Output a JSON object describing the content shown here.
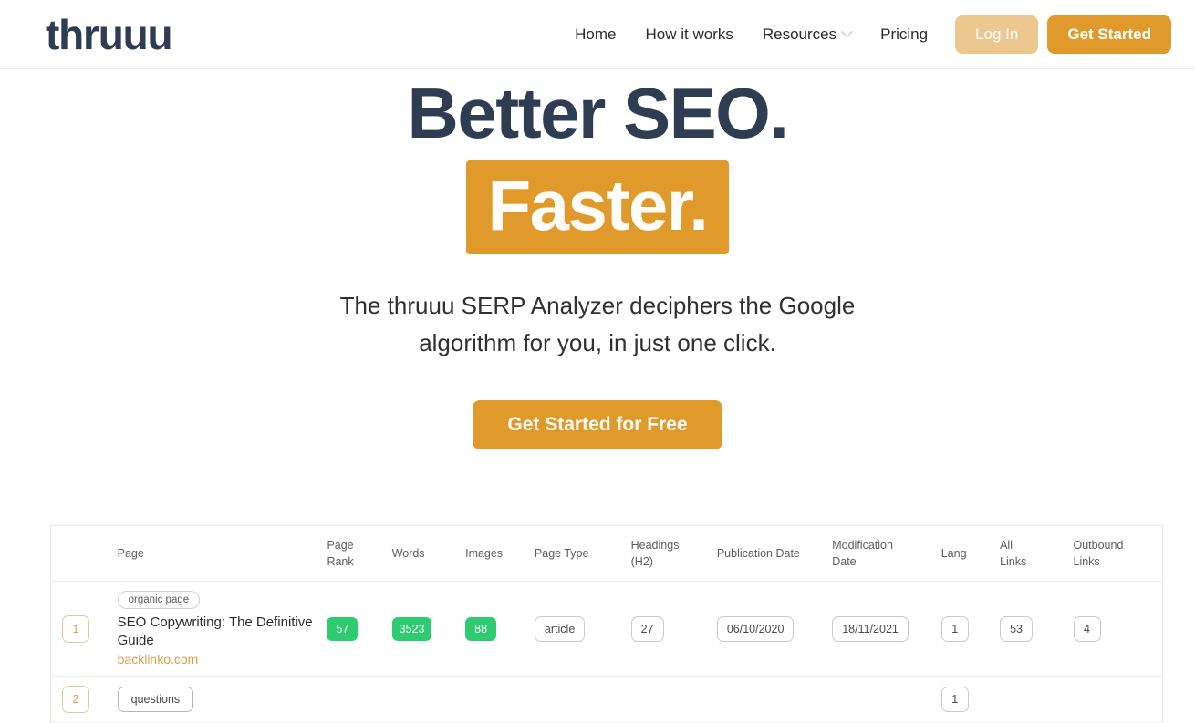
{
  "header": {
    "logo": "thruuu",
    "nav": [
      {
        "label": "Home",
        "has_chevron": false,
        "icon": ""
      },
      {
        "label": "How it works",
        "has_chevron": false,
        "icon": ""
      },
      {
        "label": "Resources",
        "has_chevron": true,
        "icon": "chevron-down-icon"
      },
      {
        "label": "Pricing",
        "has_chevron": false,
        "icon": ""
      }
    ],
    "login_label": "Log In",
    "get_started_label": "Get Started"
  },
  "hero": {
    "headline_line1": "Better SEO.",
    "headline_line2": "Faster.",
    "subtitle_line1": "The thruuu SERP Analyzer deciphers the Google",
    "subtitle_line2": "algorithm for you, in just one click.",
    "cta_label": "Get Started for Free"
  },
  "colors": {
    "brand_orange": "#e09a2c",
    "login_orange": "#ecc890",
    "navy": "#2e3d52",
    "green_badge": "#2ecb71",
    "rank_outline": "#e6c89a"
  },
  "table": {
    "columns": [
      {
        "key": "rank",
        "label": ""
      },
      {
        "key": "page",
        "label": "Page"
      },
      {
        "key": "pr",
        "label": "Page Rank"
      },
      {
        "key": "words",
        "label": "Words"
      },
      {
        "key": "images",
        "label": "Images"
      },
      {
        "key": "ptype",
        "label": "Page Type"
      },
      {
        "key": "head",
        "label": "Headings (H2)"
      },
      {
        "key": "pub",
        "label": "Publication Date"
      },
      {
        "key": "mod",
        "label": "Modification Date"
      },
      {
        "key": "lang",
        "label": "Lang"
      },
      {
        "key": "all",
        "label": "All Links"
      },
      {
        "key": "out",
        "label": "Outbound Links"
      }
    ],
    "column_labels_split": {
      "pr_l1": "Page",
      "pr_l2": "Rank",
      "head_l1": "Headings",
      "head_l2": "(H2)",
      "mod_l1": "Modification",
      "mod_l2": "Date",
      "all_l1": "All",
      "all_l2": "Links",
      "out_l1": "Outbound",
      "out_l2": "Links"
    },
    "rows": [
      {
        "rank": "1",
        "tag": "organic page",
        "title": "SEO Copywriting: The Definitive Guide",
        "domain": "backlinko.com",
        "page_rank": "57",
        "words": "3523",
        "images": "88",
        "page_type": "article",
        "headings_h2": "27",
        "publication_date": "06/10/2020",
        "modification_date": "18/11/2021",
        "lang": "1",
        "all_links": "53",
        "outbound_links": "4"
      },
      {
        "rank": "2",
        "tag": "questions",
        "title": "",
        "domain": "",
        "page_rank": "",
        "words": "",
        "images": "",
        "page_type": "",
        "headings_h2": "",
        "publication_date": "",
        "modification_date": "",
        "lang": "1",
        "all_links": "",
        "outbound_links": ""
      }
    ]
  }
}
